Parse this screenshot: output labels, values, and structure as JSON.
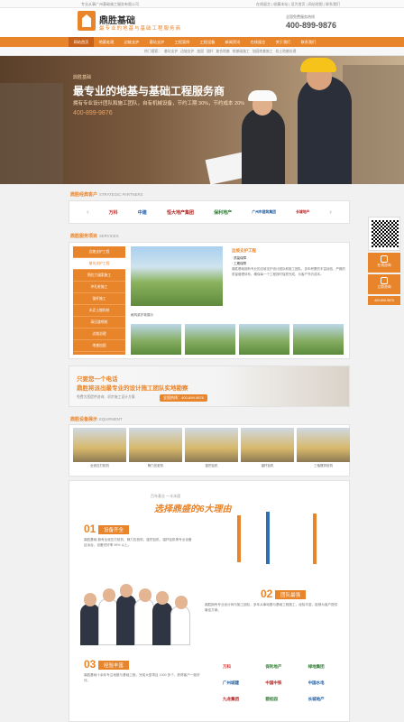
{
  "topbar": {
    "left": "专业从事广州基础施工服务有限公司",
    "right": "在线留言 | 收藏本站 | 设为首页 | 网站地图 | 联系我们"
  },
  "header": {
    "brand": "鼎胜基础",
    "slogan": "最专业的地基与基础工程服务商",
    "phone_label": "全国免费服务热线",
    "phone": "400-899-9876"
  },
  "nav": [
    "网站首页",
    "地基处理",
    "边坡支护",
    "基坑支护",
    "工程案例",
    "工程设备",
    "新闻资讯",
    "在线留言",
    "关于我们",
    "联系我们"
  ],
  "subnav": [
    "热门搜索：",
    "基坑支护",
    "边坡支护",
    "加固",
    "锚杆",
    "复合地基",
    "桩基础施工",
    "加固地基施工",
    "软土地基处理"
  ],
  "banner": {
    "tag": "鼎胜基础",
    "title": "最专业的地基与基础工程服务商",
    "sub": "拥有专业设计团队和施工团队，自有机械设备，节约工期 30%，节约成本 20%",
    "phone": "400-899-9876"
  },
  "partners": {
    "title": "鼎胜经典客户",
    "en": "STRATEGIC PARTNERS",
    "items": [
      "万科",
      "中建",
      "恒大地产集团",
      "保利地产",
      "广州市建筑集团",
      "长城地产"
    ]
  },
  "services": {
    "title": "鼎胜服务项目",
    "en": "SERVICES",
    "menu": [
      "边坡支护工程",
      "基坑支护工程",
      "预应力锚索施工",
      "冲孔桩施工",
      "锚杆施工",
      "水泥土搅拌桩",
      "高压旋喷桩",
      "边坡治理",
      "地基加固"
    ],
    "img_title": "边坡支护工程",
    "item1": "· 质量保障",
    "item2": "· 工期保障",
    "text": "鼎胜基础拥有专业的边坡支护设计团队和施工团队，多年积累的丰富经验，严格的质量管理体系，确保每一个工程按时保质完成，为客户节约成本。",
    "caption": "格构梁护坡展示"
  },
  "call": {
    "l1": "只要您一个电话",
    "l2": "鼎胜将派出最专业的设计施工团队实地勘察",
    "l3": "免费为您提供咨询、初步施工设计方案",
    "btn": "全国热线：400-899-9876"
  },
  "equipment": {
    "title": "鼎胜设备展示",
    "en": "EQUIPMENT",
    "items": [
      "全液压打桩机",
      "静力压桩机",
      "旋挖钻机",
      "锚杆钻机",
      "三轴搅拌桩机"
    ]
  },
  "reasons": {
    "small": "百年基业 一丰永固",
    "head": "选择鼎盛的6大理由",
    "r1n": "01",
    "r1": "设备齐全",
    "r1t": "鼎胜基础 拥有全液压打桩机、静力压桩机、旋挖钻机、锚杆钻机等专业设备百余台，设备完好率 95% 以上。",
    "r2n": "02",
    "r2": "团队最强",
    "r2t": "鼎胜拥有专业设计师与施工团队，多年从事地基与基础工程施工，经验丰富，能够为客户提供最佳方案。",
    "r3n": "03",
    "r3": "经验丰富",
    "r3t": "鼎胜基础十余年专注地基与基础工程，完成大型项目 1000 多个，获得客户一致好评。"
  },
  "logos": [
    "万科",
    "保利地产",
    "绿地集团",
    "广州城建",
    "中国中铁",
    "中国水电",
    "九龙集团",
    "碧桂园",
    "长城地产"
  ],
  "side": {
    "b1": "在线咨询",
    "b2": "立即咨询",
    "phone": "400-899-9876"
  }
}
